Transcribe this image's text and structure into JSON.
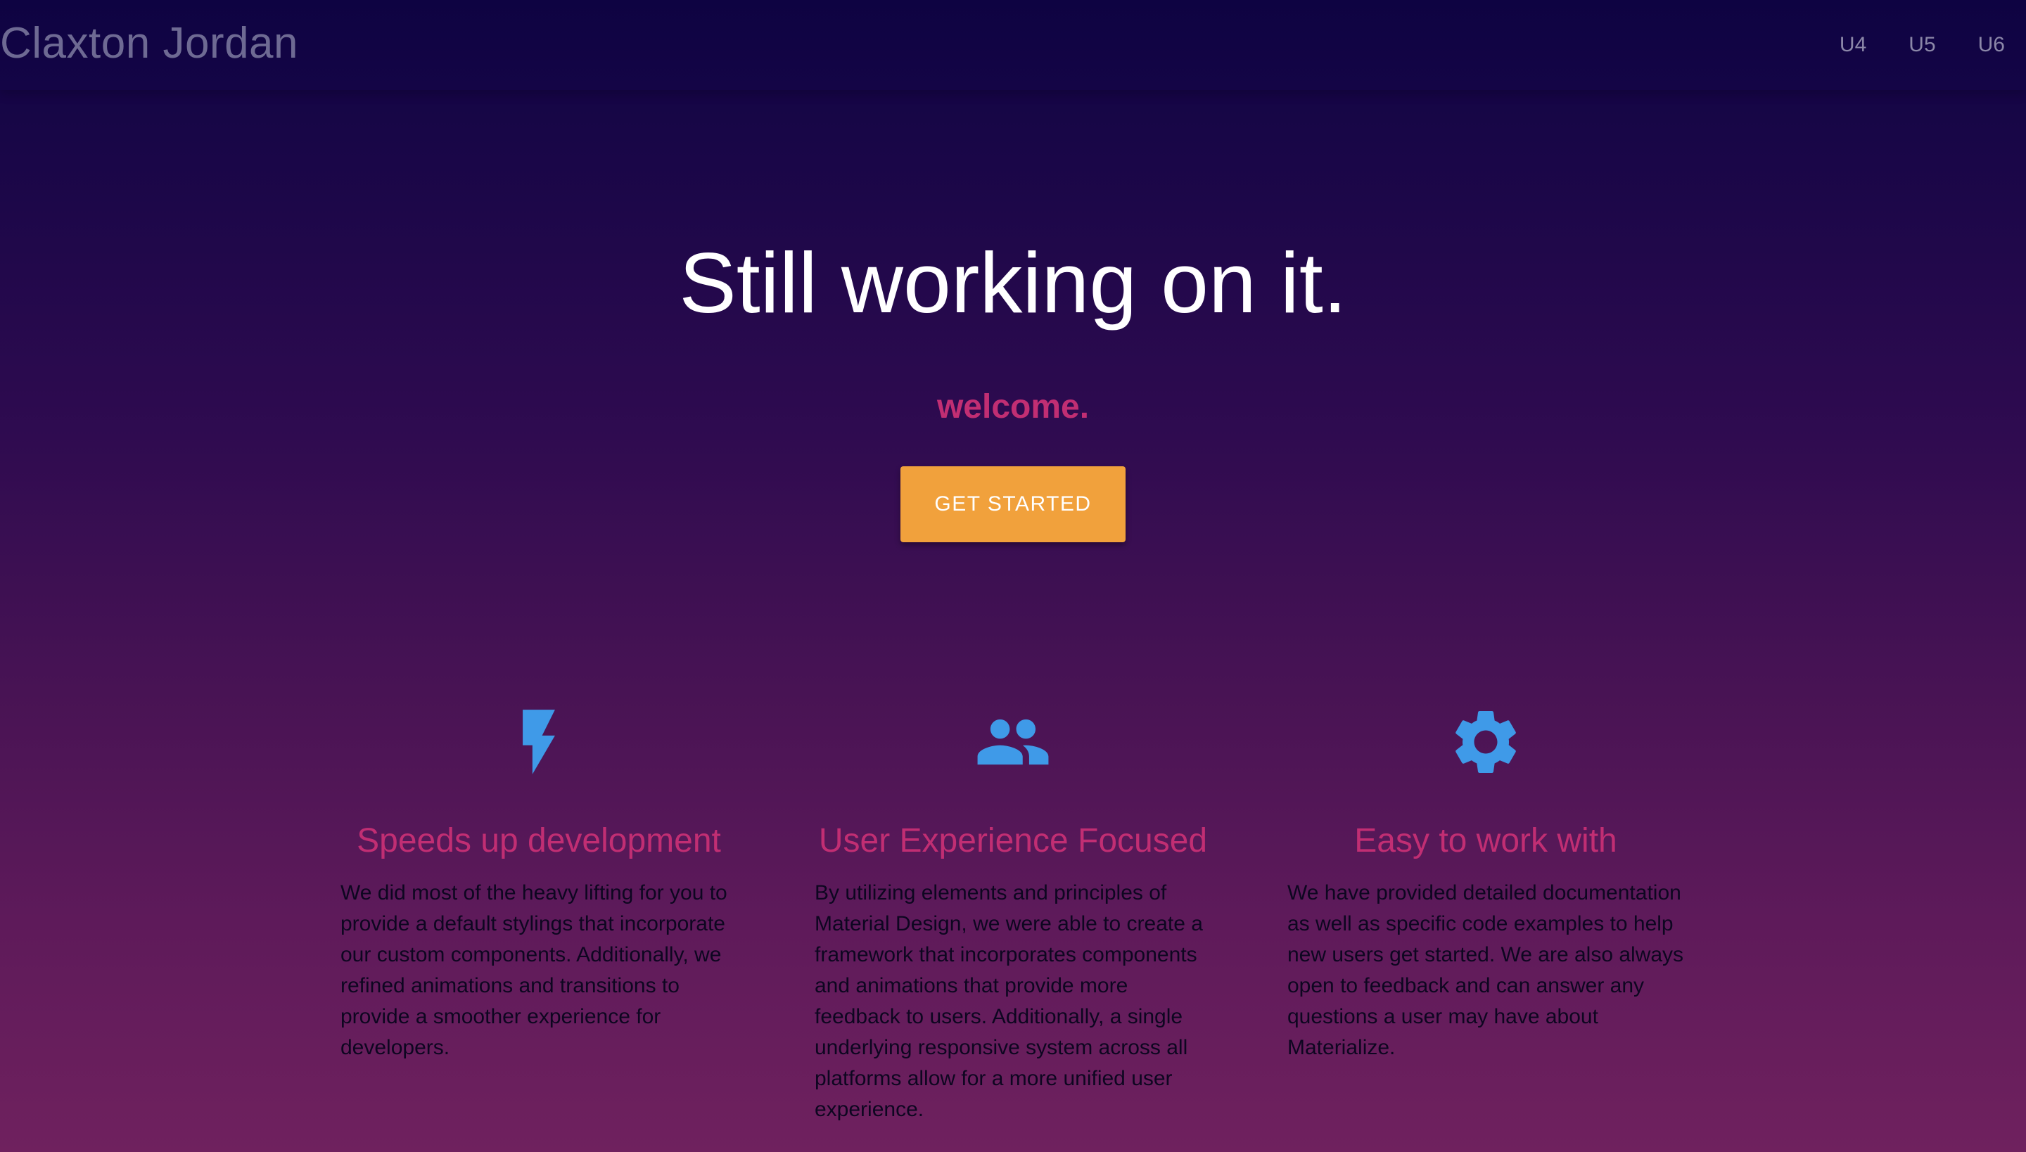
{
  "navbar": {
    "brand": "Claxton Jordan",
    "links": [
      "U4",
      "U5",
      "U6"
    ]
  },
  "hero": {
    "title": "Still working on it.",
    "subtitle": "welcome.",
    "cta_label": "GET STARTED"
  },
  "features": [
    {
      "icon": "flash-icon",
      "title": "Speeds up development",
      "text": "We did most of the heavy lifting for you to provide a default stylings that incorporate our custom components. Additionally, we refined animations and transitions to provide a smoother experience for developers."
    },
    {
      "icon": "group-icon",
      "title": "User Experience Focused",
      "text": "By utilizing elements and principles of Material Design, we were able to create a framework that incorporates components and animations that provide more feedback to users. Additionally, a single underlying responsive system across all platforms allow for a more unified user experience."
    },
    {
      "icon": "settings-icon",
      "title": "Easy to work with",
      "text": "We have provided detailed documentation as well as specific code examples to help new users get started. We are also always open to feedback and can answer any questions a user may have about Materialize."
    }
  ],
  "colors": {
    "accent_pink": "#c12e73",
    "button_orange": "#f1a13c",
    "icon_blue": "#3f9ae8",
    "navbar_bg": "#0e0342"
  }
}
